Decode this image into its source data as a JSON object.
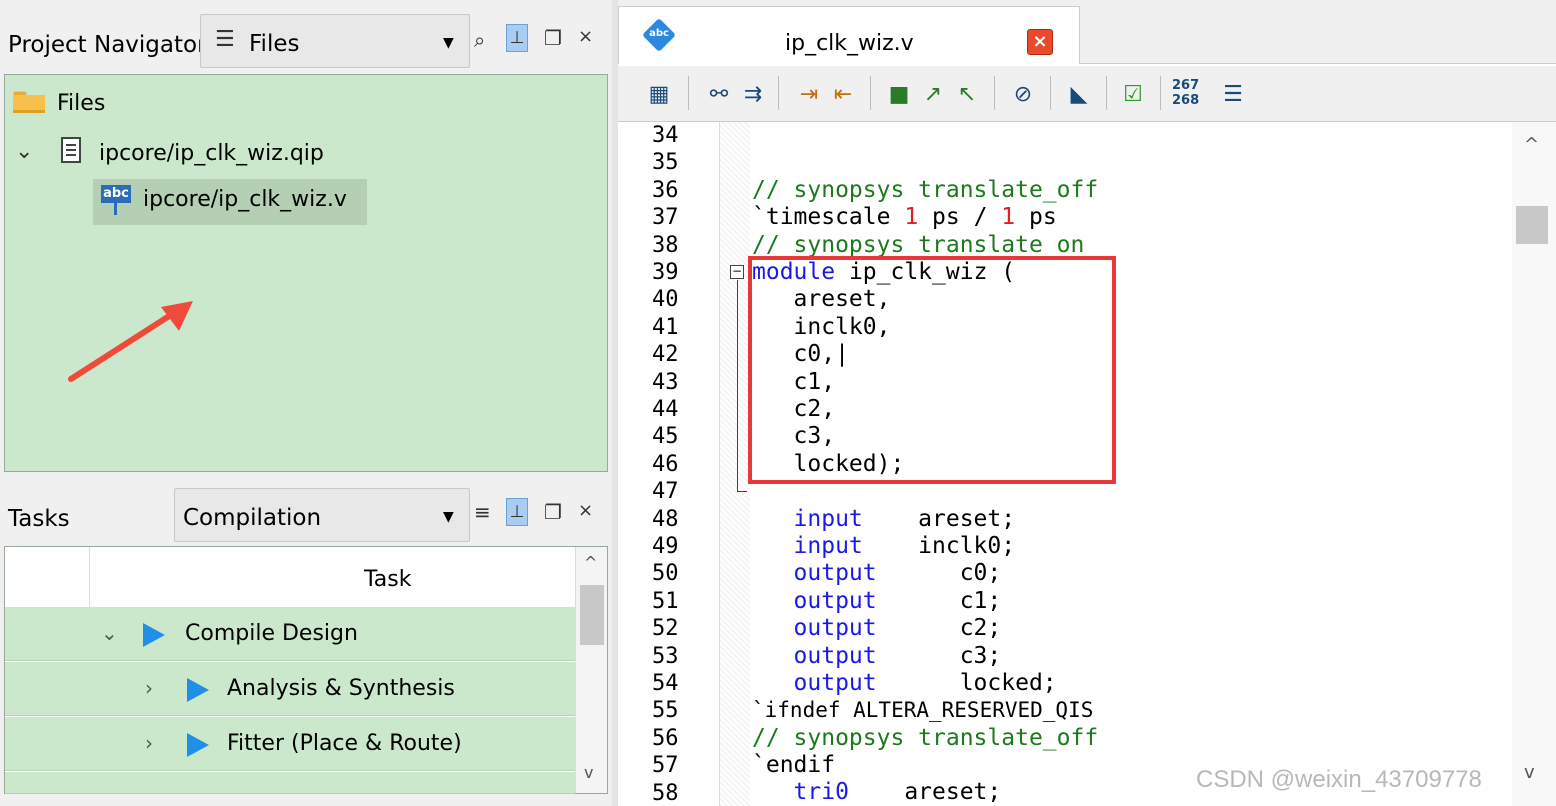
{
  "navigator": {
    "title": "Project Navigator",
    "combo_value": "Files",
    "icons": [
      "dropdown-icon",
      "search-icon",
      "pin-icon",
      "float-icon",
      "close-icon"
    ]
  },
  "files_tree": {
    "root": "Files",
    "items": [
      {
        "label": "ipcore/ip_clk_wiz.qip",
        "expanded": true
      },
      {
        "label": "ipcore/ip_clk_wiz.v",
        "selected": true
      }
    ]
  },
  "tasks": {
    "title": "Tasks",
    "combo_value": "Compilation",
    "column_header": "Task",
    "rows": [
      {
        "label": "Compile Design",
        "expanded": true
      },
      {
        "label": "Analysis & Synthesis",
        "expanded": false
      },
      {
        "label": "Fitter (Place & Route)",
        "expanded": false
      }
    ]
  },
  "editor": {
    "tab_title": "ip_clk_wiz.v",
    "toolbar_line_numbers": [
      "267",
      "268"
    ],
    "line_numbers": [
      "34",
      "35",
      "36",
      "37",
      "38",
      "39",
      "40",
      "41",
      "42",
      "43",
      "44",
      "45",
      "46",
      "47",
      "48",
      "49",
      "50",
      "51",
      "52",
      "53",
      "54",
      "55",
      "56",
      "57",
      "58"
    ],
    "code": {
      "l36": "// synopsys translate_off",
      "l37_a": "`timescale ",
      "l37_n1": "1",
      "l37_b": " ps / ",
      "l37_n2": "1",
      "l37_c": " ps",
      "l38": "// synopsys translate_on",
      "l39_kw": "module",
      "l39_rest": " ip_clk_wiz (",
      "l40": "   areset,",
      "l41": "   inclk0,",
      "l42": "   c0,|",
      "l43": "   c1,",
      "l44": "   c2,",
      "l45": "   c3,",
      "l46": "   locked);",
      "l48_kw": "   input",
      "l48_rest": "    areset;",
      "l49_kw": "   input",
      "l49_rest": "    inclk0;",
      "l50_kw": "   output",
      "l50_rest": "      c0;",
      "l51_kw": "   output",
      "l51_rest": "      c1;",
      "l52_kw": "   output",
      "l52_rest": "      c2;",
      "l53_kw": "   output",
      "l53_rest": "      c3;",
      "l54_kw": "   output",
      "l54_rest": "      locked;",
      "l55": "`ifndef ALTERA_RESERVED_QIS",
      "l56": "// synopsys translate_off",
      "l57": "`endif",
      "l58_kw": "   tri0",
      "l58_rest": "    areset;"
    }
  },
  "watermark": "CSDN @weixin_43709778",
  "colors": {
    "tree_bg": "#cce8cc",
    "keyword": "#1a1ae8",
    "comment": "#1c7a1c",
    "number": "#e02020",
    "highlight_box": "#e83838",
    "annotation_arrow": "#f04a3a"
  }
}
